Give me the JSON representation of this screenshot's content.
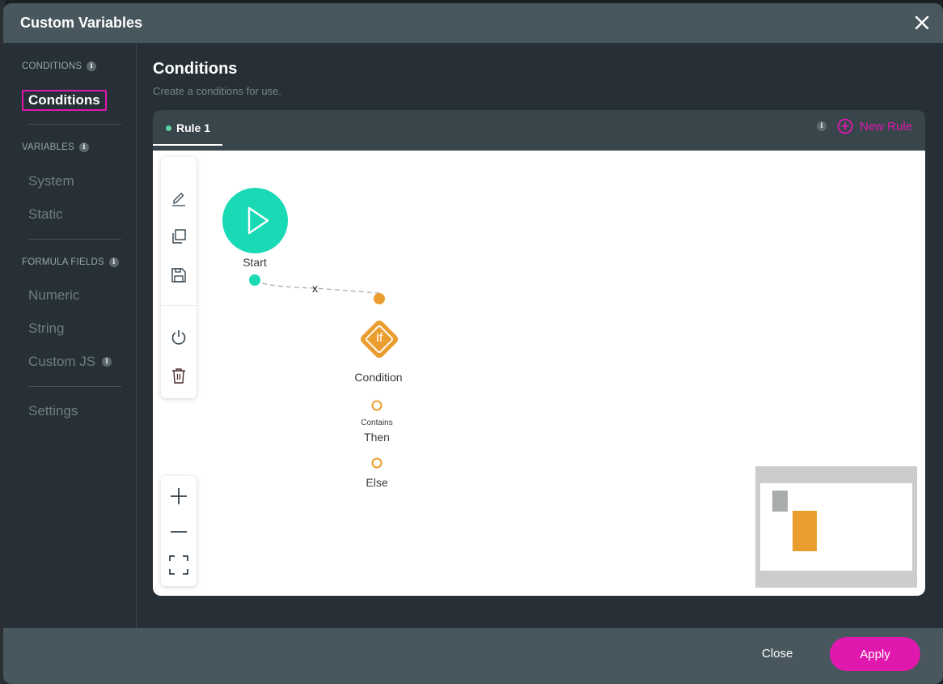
{
  "modal": {
    "title": "Custom Variables",
    "close_icon": "close-icon"
  },
  "sidebar": {
    "sections": [
      {
        "label": "CONDITIONS",
        "info": "i",
        "items": [
          {
            "label": "Conditions",
            "active": true
          }
        ]
      },
      {
        "label": "VARIABLES",
        "info": "i",
        "items": [
          {
            "label": "System"
          },
          {
            "label": "Static"
          }
        ]
      },
      {
        "label": "FORMULA FIELDS",
        "info": "i",
        "items": [
          {
            "label": "Numeric"
          },
          {
            "label": "String"
          },
          {
            "label": "Custom JS",
            "info": "i"
          }
        ]
      }
    ],
    "settings_label": "Settings"
  },
  "main": {
    "title": "Conditions",
    "subtitle": "Create a conditions for use.",
    "tabs": [
      {
        "label": "Rule 1",
        "status_color": "#5ed3a3"
      }
    ],
    "info": "i",
    "new_rule_label": "New Rule"
  },
  "canvas": {
    "toolbar_icons": [
      "edit-icon",
      "copy-icon",
      "save-icon",
      "power-icon",
      "trash-icon"
    ],
    "zoom_icons": [
      "zoom-in-icon",
      "zoom-out-icon",
      "fit-screen-icon"
    ],
    "nodes": {
      "start": {
        "label": "Start",
        "color": "#1ad9b5"
      },
      "condition": {
        "label": "Condition",
        "glyph": "If",
        "color": "#eb9e30"
      },
      "then": {
        "sublabel": "Contains",
        "label": "Then"
      },
      "else": {
        "label": "Else"
      }
    },
    "edge_label": "x"
  },
  "footer": {
    "close_label": "Close",
    "apply_label": "Apply"
  },
  "colors": {
    "accent": "#e018ae",
    "start_node": "#1ad9b5",
    "condition_node": "#eb9e30"
  }
}
